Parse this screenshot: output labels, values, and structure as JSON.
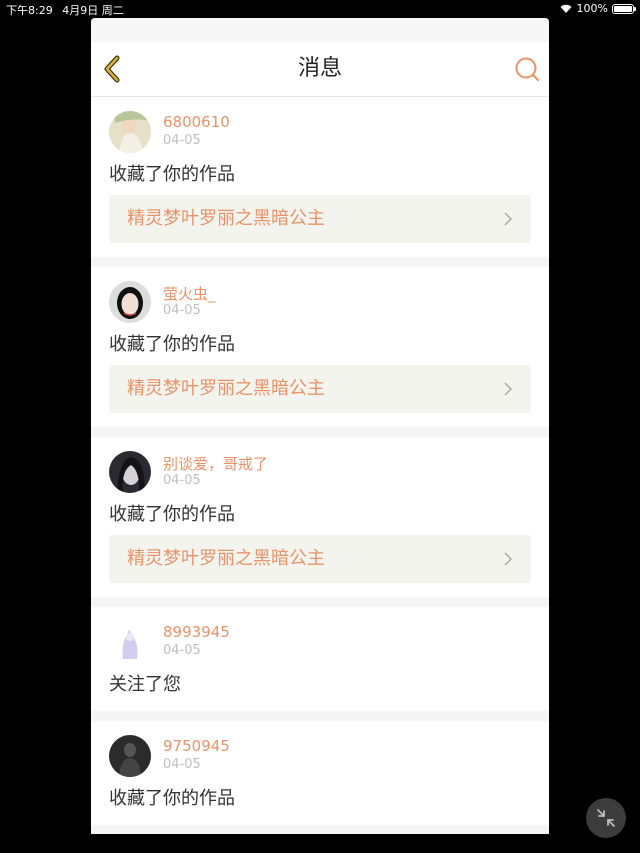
{
  "status_bar": {
    "time": "下午8:29",
    "date": "4月9日 周二",
    "battery": "100%"
  },
  "header": {
    "title": "消息"
  },
  "icons": {
    "back": "chevron-left-icon",
    "search": "search-icon",
    "float": "collapse-icon"
  },
  "colors": {
    "accent": "#e8936a",
    "back_icon": "#d9b23a"
  },
  "messages": [
    {
      "username": "6800610",
      "date": "04-05",
      "action": "收藏了你的作品",
      "work": "精灵梦叶罗丽之黑暗公主"
    },
    {
      "username": "萤火虫_",
      "date": "04-05",
      "action": "收藏了你的作品",
      "work": "精灵梦叶罗丽之黑暗公主"
    },
    {
      "username": "别谈爱，哥戒了",
      "date": "04-05",
      "action": "收藏了你的作品",
      "work": "精灵梦叶罗丽之黑暗公主"
    },
    {
      "username": "8993945",
      "date": "04-05",
      "action": "关注了您"
    },
    {
      "username": "9750945",
      "date": "04-05",
      "action": "收藏了你的作品"
    }
  ]
}
